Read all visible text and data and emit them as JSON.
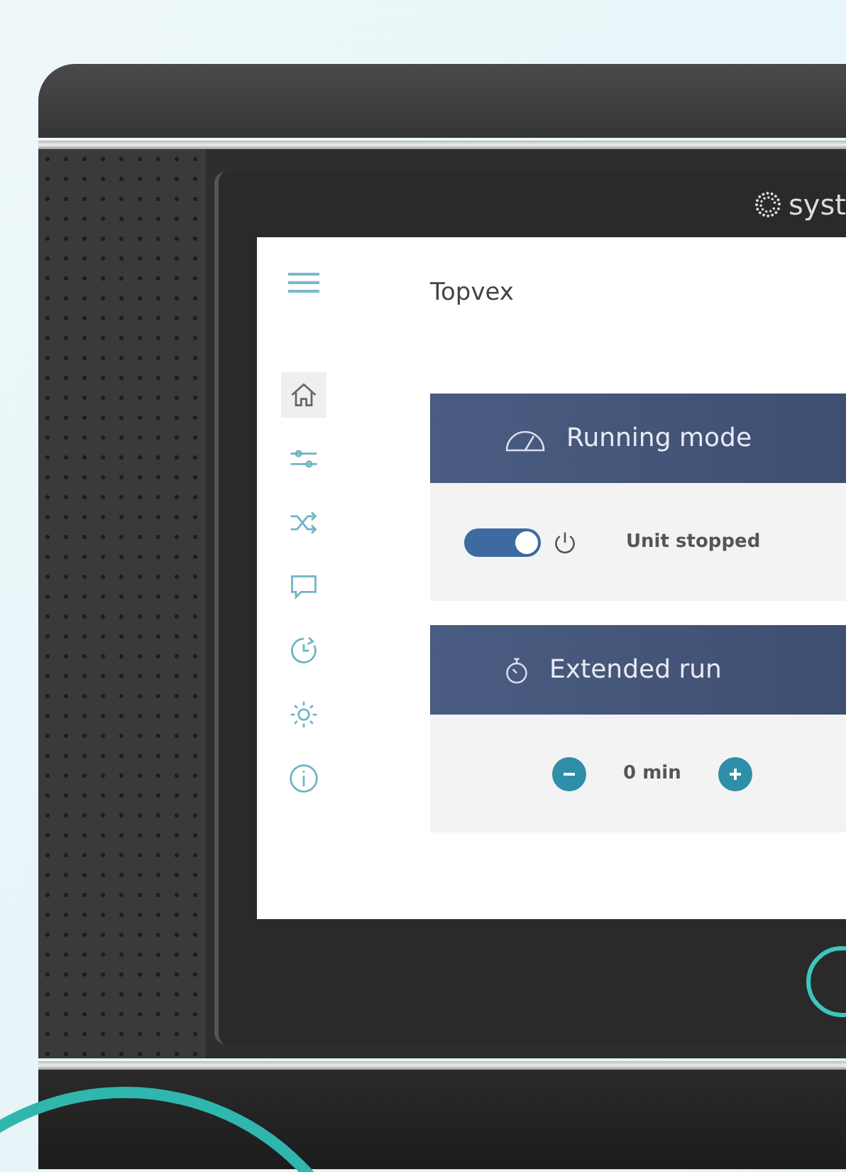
{
  "device": {
    "logo": "syst"
  },
  "screen": {
    "title": "Topvex",
    "sidebar": {
      "items": [
        {
          "selected": true
        },
        {
          "selected": false
        },
        {
          "selected": false
        },
        {
          "selected": false
        },
        {
          "selected": false
        },
        {
          "selected": false
        },
        {
          "selected": false
        }
      ]
    },
    "cards": [
      {
        "kind": "toggle",
        "title": "Running mode",
        "on": true,
        "label": "Unit stopped"
      },
      {
        "kind": "stepper",
        "title": "Extended run",
        "value": "0 min"
      }
    ]
  }
}
